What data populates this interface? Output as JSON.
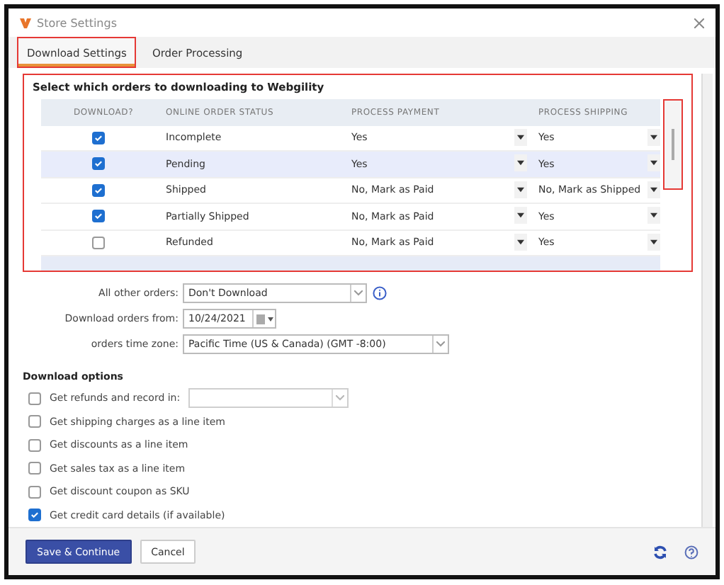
{
  "window": {
    "title": "Store Settings"
  },
  "tabs": [
    {
      "label": "Download Settings",
      "selected": true,
      "highlighted": true
    },
    {
      "label": "Order Processing",
      "selected": false,
      "highlighted": false
    }
  ],
  "orders_panel": {
    "title": "Select which orders to downloading to Webgility",
    "highlighted": true,
    "scrollbar_highlighted": true,
    "columns": [
      "DOWNLOAD?",
      "ONLINE ORDER STATUS",
      "PROCESS PAYMENT",
      "PROCESS SHIPPING"
    ],
    "rows": [
      {
        "download": true,
        "status": "Incomplete",
        "payment": "Yes",
        "shipping": "Yes",
        "selected": false
      },
      {
        "download": true,
        "status": "Pending",
        "payment": "Yes",
        "shipping": "Yes",
        "selected": true
      },
      {
        "download": true,
        "status": "Shipped",
        "payment": "No, Mark as Paid",
        "shipping": "No, Mark as Shipped",
        "selected": false
      },
      {
        "download": true,
        "status": "Partially Shipped",
        "payment": "No, Mark as Paid",
        "shipping": "Yes",
        "selected": false
      },
      {
        "download": false,
        "status": "Refunded",
        "payment": "No, Mark as Paid",
        "shipping": "Yes",
        "selected": false
      }
    ]
  },
  "fields": [
    {
      "kind": "select",
      "label": "All other orders:",
      "value": "Don't Download",
      "info": true
    },
    {
      "kind": "date",
      "label": "Download orders from:",
      "value": "10/24/2021",
      "info": false
    },
    {
      "kind": "wide-select",
      "label": "orders time zone:",
      "value": "Pacific Time (US & Canada) (GMT -8:00)",
      "info": false
    }
  ],
  "download_options": {
    "heading": "Download options",
    "items": [
      {
        "label": "Get refunds and record in:",
        "checked": false,
        "kind": "with-select"
      },
      {
        "label": "Get shipping charges as a line item",
        "checked": false,
        "kind": "plain"
      },
      {
        "label": "Get discounts as a line item",
        "checked": false,
        "kind": "plain"
      },
      {
        "label": "Get sales tax as a line item",
        "checked": false,
        "kind": "plain"
      },
      {
        "label": "Get discount coupon as SKU",
        "checked": false,
        "kind": "plain"
      },
      {
        "label": "Get credit card details (if available)",
        "checked": true,
        "kind": "plain"
      }
    ]
  },
  "buttons": [
    {
      "label": "Save & Continue",
      "kind": "primary"
    },
    {
      "label": "Cancel",
      "kind": "secondary"
    }
  ]
}
